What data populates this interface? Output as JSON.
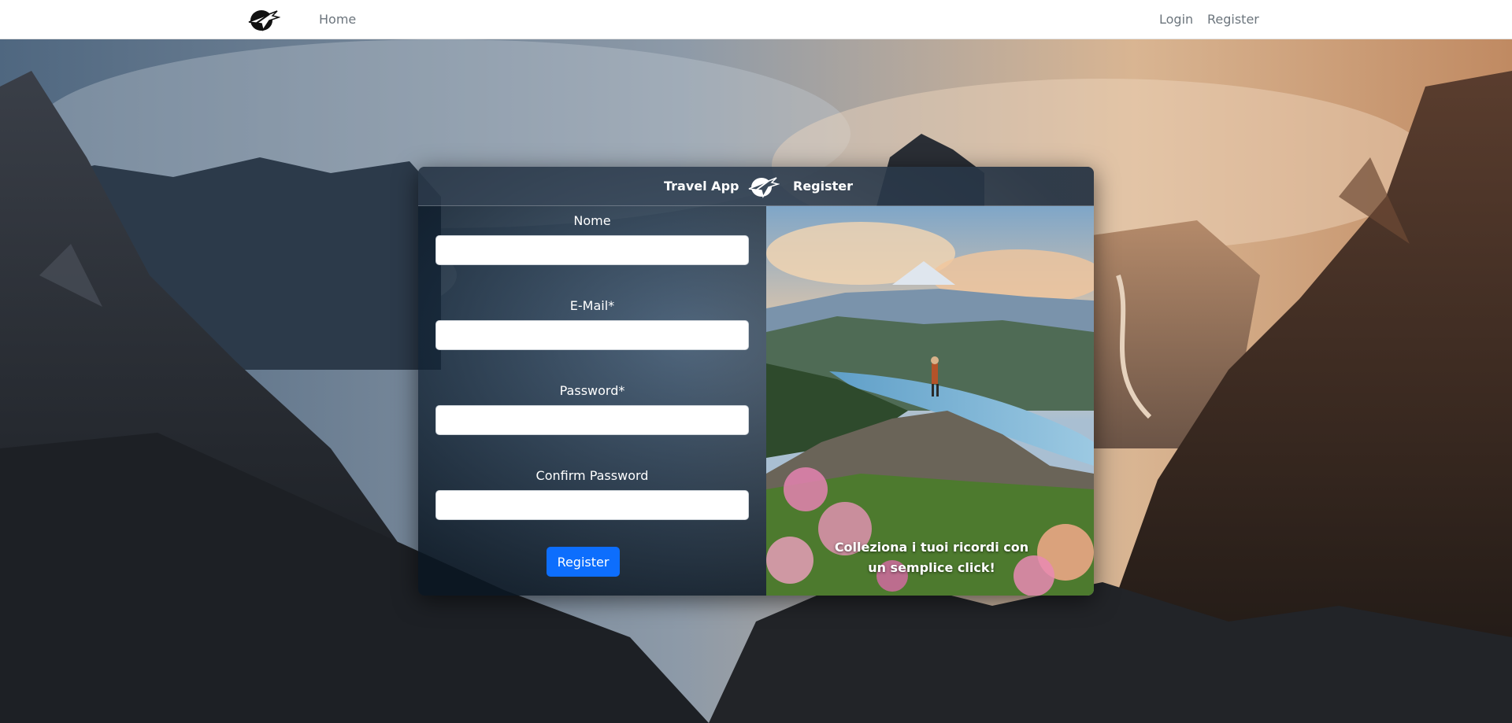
{
  "navbar": {
    "logo_icon": "astronaut-plane-logo-icon",
    "home_label": "Home",
    "login_label": "Login",
    "register_label": "Register"
  },
  "card": {
    "title": "Travel App",
    "logo_icon": "astronaut-plane-logo-icon",
    "subtitle": "Register",
    "fields": [
      {
        "label": "Nome",
        "value": "",
        "placeholder": ""
      },
      {
        "label": "E-Mail*",
        "value": "",
        "placeholder": ""
      },
      {
        "label": "Password*",
        "value": "",
        "placeholder": ""
      },
      {
        "label": "Confirm Password",
        "value": "",
        "placeholder": ""
      }
    ],
    "submit_label": "Register",
    "caption_line1": "Colleziona i tuoi ricordi con",
    "caption_line2": "un semplice click!"
  },
  "colors": {
    "primary": "#0d6efd",
    "nav_link": "#6c757d",
    "navbar_bg": "#ffffff"
  }
}
